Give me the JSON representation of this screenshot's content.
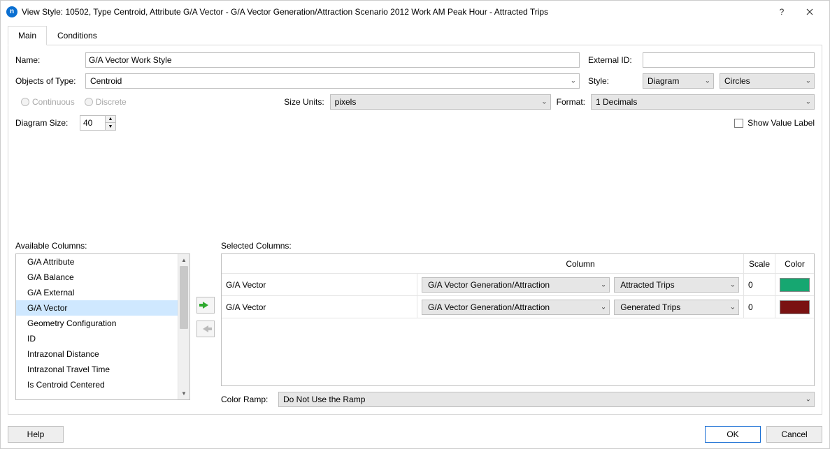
{
  "title": "View Style: 10502, Type Centroid, Attribute G/A Vector - G/A Vector Generation/Attraction Scenario 2012 Work AM Peak Hour - Attracted Trips",
  "tabs": {
    "main": "Main",
    "conditions": "Conditions"
  },
  "labels": {
    "name": "Name:",
    "external_id": "External ID:",
    "objects_of_type": "Objects of Type:",
    "style": "Style:",
    "continuous": "Continuous",
    "discrete": "Discrete",
    "size_units": "Size Units:",
    "format": "Format:",
    "diagram_size": "Diagram Size:",
    "show_value_label": "Show Value Label",
    "available_columns": "Available Columns:",
    "selected_columns": "Selected Columns:",
    "grid_column": "Column",
    "grid_scale": "Scale",
    "grid_color": "Color",
    "color_ramp": "Color Ramp:"
  },
  "values": {
    "name": "G/A Vector Work Style",
    "external_id": "",
    "objects_of_type": "Centroid",
    "style1": "Diagram",
    "style2": "Circles",
    "size_units": "pixels",
    "format": "1 Decimals",
    "diagram_size": "40",
    "color_ramp": "Do Not Use the Ramp"
  },
  "available_columns": [
    "G/A Attribute",
    "G/A Balance",
    "G/A External",
    "G/A Vector",
    "Geometry Configuration",
    "ID",
    "Intrazonal Distance",
    "Intrazonal Travel Time",
    "Is Centroid Centered"
  ],
  "available_selected_index": 3,
  "selected_columns": [
    {
      "name": "G/A Vector",
      "c1": "G/A Vector Generation/Attraction",
      "c2": "Attracted Trips",
      "scale": "0",
      "color": "#16a771"
    },
    {
      "name": "G/A Vector",
      "c1": "G/A Vector Generation/Attraction",
      "c2": "Generated Trips",
      "scale": "0",
      "color": "#7a1212"
    }
  ],
  "buttons": {
    "help": "Help",
    "ok": "OK",
    "cancel": "Cancel"
  }
}
